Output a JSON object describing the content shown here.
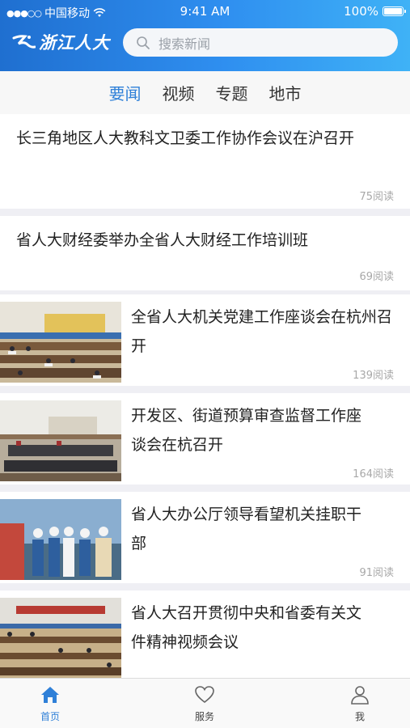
{
  "status": {
    "carrier": "中国移动",
    "time": "9:41 AM",
    "battery": "100%"
  },
  "header": {
    "logo_text": "浙江人大",
    "search_placeholder": "搜索新闻"
  },
  "tabs": [
    {
      "label": "要闻",
      "active": true
    },
    {
      "label": "视频",
      "active": false
    },
    {
      "label": "专题",
      "active": false
    },
    {
      "label": "地市",
      "active": false
    }
  ],
  "news": [
    {
      "title": "长三角地区人大教科文卫委工作协作会议在沪召开",
      "reads": "75阅读"
    },
    {
      "title": "省人大财经委举办全省人大财经工作培训班",
      "reads": "69阅读"
    },
    {
      "title": "全省人大机关党建工作座谈会在杭州召开",
      "reads": "139阅读"
    },
    {
      "title": "开发区、街道预算审查监督工作座谈会在杭召开",
      "reads": "164阅读"
    },
    {
      "title": "省人大办公厅领导看望机关挂职干部",
      "reads": "91阅读"
    },
    {
      "title": "省人大召开贯彻中央和省委有关文件精神视频会议",
      "reads": ""
    }
  ],
  "tabbar": [
    {
      "label": "首页",
      "icon": "home-icon",
      "active": true
    },
    {
      "label": "服务",
      "icon": "heart-icon",
      "active": false
    },
    {
      "label": "我",
      "icon": "user-icon",
      "active": false
    }
  ],
  "colors": {
    "accent": "#2f80d8",
    "header_start": "#1f6fd0",
    "header_end": "#3fb2f6"
  }
}
